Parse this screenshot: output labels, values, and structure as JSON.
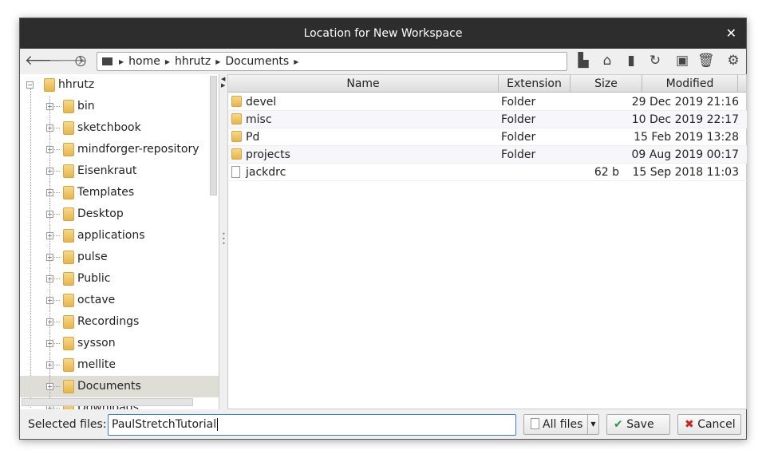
{
  "title": "Location for New Workspace",
  "toolbar": {
    "breadcrumb": [
      "home",
      "hhrutz",
      "Documents"
    ],
    "icons": [
      "back-icon",
      "forward-icon",
      "history-icon",
      "computer-icon",
      "parent-folder-icon",
      "home-icon",
      "bookmarks-icon",
      "refresh-icon",
      "new-folder-icon",
      "delete-icon",
      "settings-icon"
    ]
  },
  "tree": {
    "root": "hhrutz",
    "items": [
      "bin",
      "sketchbook",
      "mindforger-repository",
      "Eisenkraut",
      "Templates",
      "Desktop",
      "applications",
      "pulse",
      "Public",
      "octave",
      "Recordings",
      "sysson",
      "mellite",
      "Documents",
      "Downloads"
    ],
    "selected": "Documents"
  },
  "columns": [
    "Name",
    "Extension",
    "Size",
    "Modified"
  ],
  "files": [
    {
      "name": "devel",
      "ext": "Folder",
      "size": "",
      "modified": "29 Dec 2019 21:16",
      "type": "folder"
    },
    {
      "name": "misc",
      "ext": "Folder",
      "size": "",
      "modified": "10 Dec 2019 22:17",
      "type": "folder"
    },
    {
      "name": "Pd",
      "ext": "Folder",
      "size": "",
      "modified": "15 Feb 2019 13:28",
      "type": "folder"
    },
    {
      "name": "projects",
      "ext": "Folder",
      "size": "",
      "modified": "09 Aug 2019 00:17",
      "type": "folder"
    },
    {
      "name": "jackdrc",
      "ext": "",
      "size": "62 b",
      "modified": "15 Sep 2018 11:03",
      "type": "file"
    }
  ],
  "bottom": {
    "label": "Selected files:",
    "value": "PaulStretchTutorial",
    "filter": "All files",
    "save": "Save",
    "cancel": "Cancel"
  },
  "colors": {
    "titlebar": "#2d2d2d",
    "selection": "#deded6",
    "input_border": "#3a7bd5"
  }
}
